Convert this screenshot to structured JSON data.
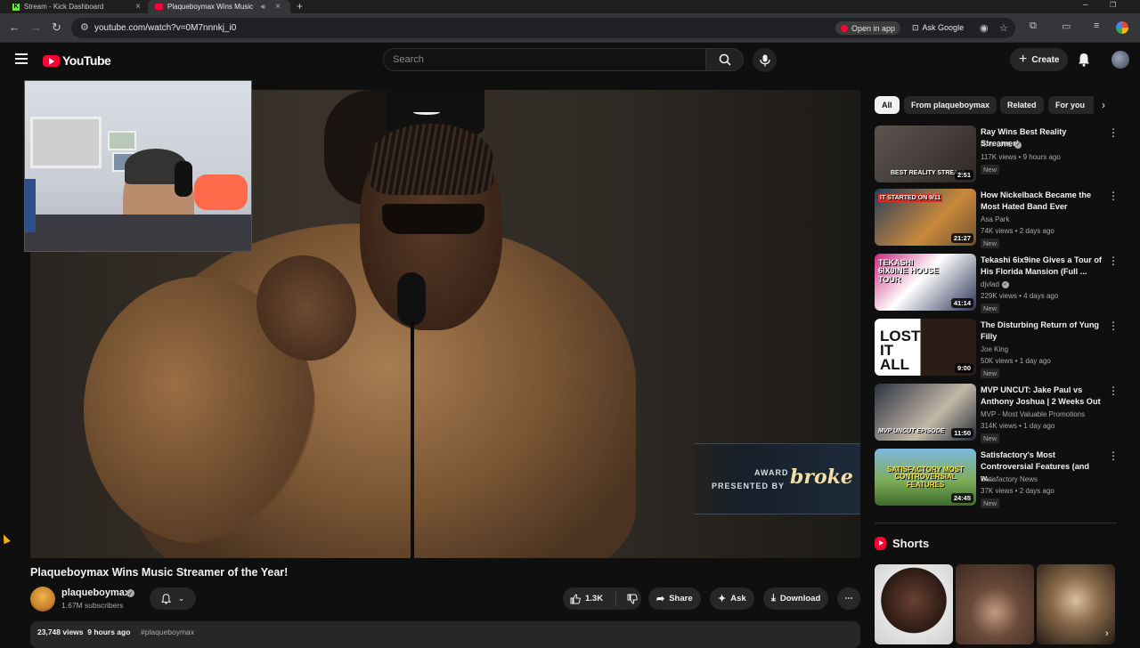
{
  "browser": {
    "tabs": [
      {
        "title": "Stream - Kick Dashboard",
        "favicon": "kick-icon"
      },
      {
        "title": "Plaqueboymax Wins Music",
        "favicon": "youtube-icon"
      }
    ],
    "url": "youtube.com/watch?v=0M7nnnkj_i0",
    "open_in_app": "Open in app",
    "ask_google": "Ask Google"
  },
  "header": {
    "logo_text": "YouTube",
    "search_placeholder": "Search",
    "create_label": "Create"
  },
  "player": {
    "overlay_line1": "AWARD",
    "overlay_line2": "PRESENTED BY",
    "overlay_brand": "broke"
  },
  "video": {
    "title": "Plaqueboymax Wins Music Streamer of the Year!",
    "channel": "plaqueboymax",
    "subscribers": "1.67M subscribers",
    "likes": "1.3K",
    "share_label": "Share",
    "ask_label": "Ask",
    "download_label": "Download",
    "views": "23,748 views",
    "age": "9 hours ago",
    "hashtag": "#plaqueboymax"
  },
  "sidebar": {
    "chips": [
      "All",
      "From plaqueboymax",
      "Related",
      "For you"
    ],
    "recommendations": [
      {
        "title": "Ray Wins Best Reality Streamer!",
        "channel": "RAY LIVE",
        "verified": true,
        "meta": "117K views • 9 hours ago",
        "badge": "New",
        "duration": "2:51",
        "thumb_text": "BEST REALITY STREAM"
      },
      {
        "title": "How Nickelback Became the Most Hated Band Ever",
        "channel": "Asa Park",
        "verified": false,
        "meta": "74K views • 2 days ago",
        "badge": "New",
        "duration": "21:27",
        "thumb_text": "IT STARTED ON 9/11"
      },
      {
        "title": "Tekashi 6ix9ine Gives a Tour of His Florida Mansion (Full ...",
        "channel": "djvlad",
        "verified": true,
        "meta": "229K views • 4 days ago",
        "badge": "New",
        "duration": "41:14",
        "thumb_text": "TEKASHI 6IX9INE HOUSE TOUR"
      },
      {
        "title": "The Disturbing Return of Yung Filly",
        "channel": "Joe King",
        "verified": false,
        "meta": "50K views • 1 day ago",
        "badge": "New",
        "duration": "9:00",
        "thumb_text": "LOST IT ALL"
      },
      {
        "title": "MVP UNCUT: Jake Paul vs Anthony Joshua | 2 Weeks Out",
        "channel": "MVP - Most Valuable Promotions",
        "verified": false,
        "meta": "314K views • 1 day ago",
        "badge": "New",
        "duration": "11:50",
        "thumb_text": "MVP UNCUT EPISODE"
      },
      {
        "title": "Satisfactory's Most Controversial Features (and w...",
        "channel": "Satisfactory News",
        "verified": false,
        "meta": "37K views • 2 days ago",
        "badge": "New",
        "duration": "24:45",
        "thumb_text": "SATISFACTORY MOST CONTROVERSIAL FEATURES"
      }
    ],
    "shorts_title": "Shorts"
  },
  "colors": {
    "background": "#0f0f0f",
    "youtube_red": "#ff0033",
    "chip_active": "#f1f1f1",
    "surface": "#272727"
  }
}
